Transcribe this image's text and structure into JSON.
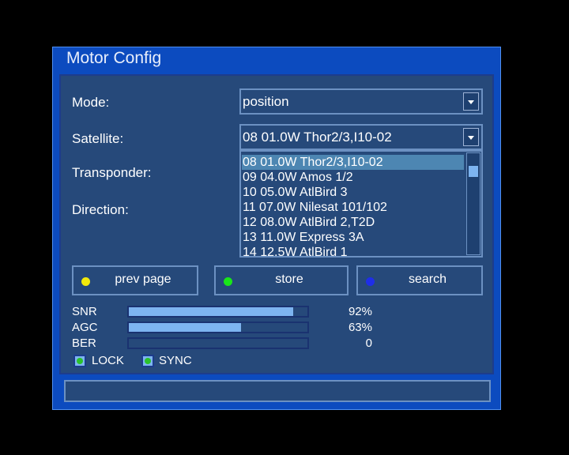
{
  "dialog": {
    "title": "Motor Config"
  },
  "form": {
    "mode_label": "Mode:",
    "mode_value": "position",
    "satellite_label": "Satellite:",
    "satellite_value": "08 01.0W Thor2/3,I10-02",
    "transponder_label": "Transponder:",
    "direction_label": "Direction:"
  },
  "satellite_list": {
    "items": [
      "08 01.0W Thor2/3,I10-02",
      "09 04.0W Amos 1/2",
      "10 05.0W AtlBird 3",
      "11 07.0W Nilesat 101/102",
      "12 08.0W AtlBird 2,T2D",
      "13 11.0W Express 3A",
      "14 12.5W AtlBird 1"
    ],
    "selected_index": 0
  },
  "buttons": {
    "prev_page": {
      "label": "prev page",
      "color": "#f2e90b"
    },
    "store": {
      "label": "store",
      "color": "#19e619"
    },
    "search": {
      "label": "search",
      "color": "#1f2ee8"
    }
  },
  "meters": {
    "snr": {
      "label": "SNR",
      "value_text": "92%",
      "level": 0.92
    },
    "agc": {
      "label": "AGC",
      "value_text": "63%",
      "level": 0.63
    },
    "ber": {
      "label": "BER",
      "value_text": "0",
      "level": 0
    }
  },
  "indicators": {
    "lock": {
      "label": "LOCK"
    },
    "sync": {
      "label": "SYNC"
    }
  },
  "colors": {
    "frame": "#0c4bbf",
    "panel": "#26497a",
    "bar_fill": "#7db4f0",
    "selection": "#4d86b2"
  }
}
